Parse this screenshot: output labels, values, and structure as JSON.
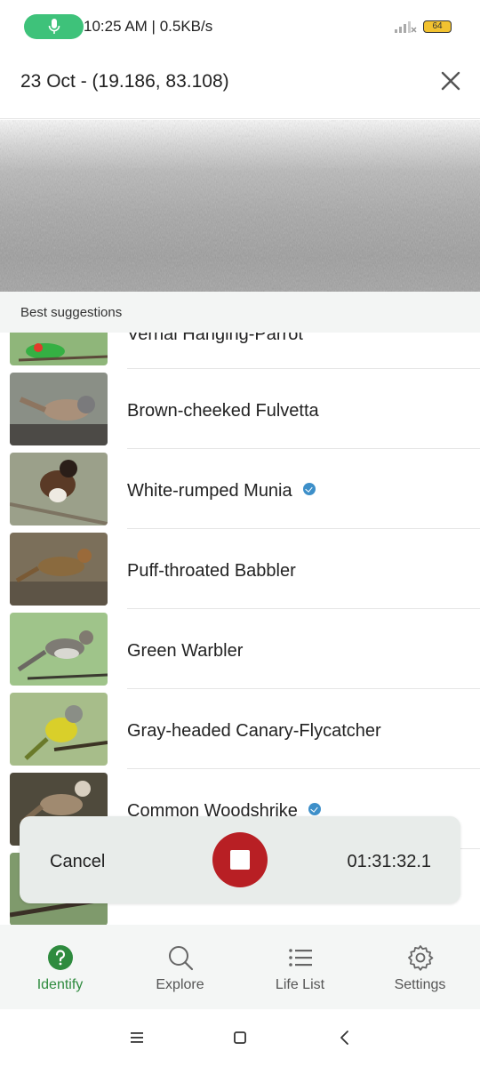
{
  "status_bar": {
    "time_speed": "10:25 AM | 0.5KB/s",
    "battery": "64",
    "mic_icon": "mic-icon",
    "pill_color": "#3ec27a"
  },
  "header": {
    "title": "23 Oct - (19.186, 83.108)",
    "close_icon": "close-icon"
  },
  "suggestions": {
    "heading": "Best suggestions",
    "items": [
      {
        "name": "Vernal Hanging-Parrot",
        "verified": false
      },
      {
        "name": "Brown-cheeked Fulvetta",
        "verified": false
      },
      {
        "name": "White-rumped Munia",
        "verified": true
      },
      {
        "name": "Puff-throated Babbler",
        "verified": false
      },
      {
        "name": "Green Warbler",
        "verified": false
      },
      {
        "name": "Gray-headed Canary-Flycatcher",
        "verified": false
      },
      {
        "name": "Common Woodshrike",
        "verified": true
      },
      {
        "name": "",
        "verified": false
      }
    ]
  },
  "recording": {
    "cancel_label": "Cancel",
    "elapsed": "01:31:32.1",
    "stop_color": "#b81f24"
  },
  "bottom_nav": {
    "items": [
      {
        "label": "Identify",
        "icon": "help-circle-icon",
        "active": true
      },
      {
        "label": "Explore",
        "icon": "search-icon",
        "active": false
      },
      {
        "label": "Life List",
        "icon": "list-icon",
        "active": false
      },
      {
        "label": "Settings",
        "icon": "gear-icon",
        "active": false
      }
    ],
    "accent": "#2e8b3e"
  }
}
